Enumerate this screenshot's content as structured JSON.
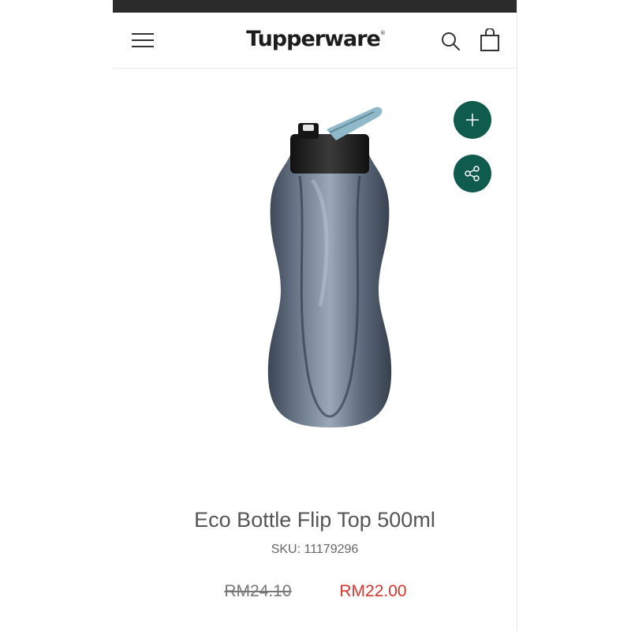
{
  "header": {
    "logo_text": "Tupperware",
    "logo_mark": "®",
    "icons": {
      "menu": "hamburger-menu-icon",
      "search": "search-icon",
      "cart": "shopping-bag-icon"
    }
  },
  "actions": {
    "add_icon": "plus-icon",
    "share_icon": "share-icon",
    "accent": "#0f5b4e"
  },
  "product": {
    "title": "Eco Bottle Flip Top 500ml",
    "sku_label": "SKU:",
    "sku_value": "11179296",
    "original_price": "RM24.10",
    "sale_price": "RM22.00",
    "sale_color": "#d9342b"
  }
}
